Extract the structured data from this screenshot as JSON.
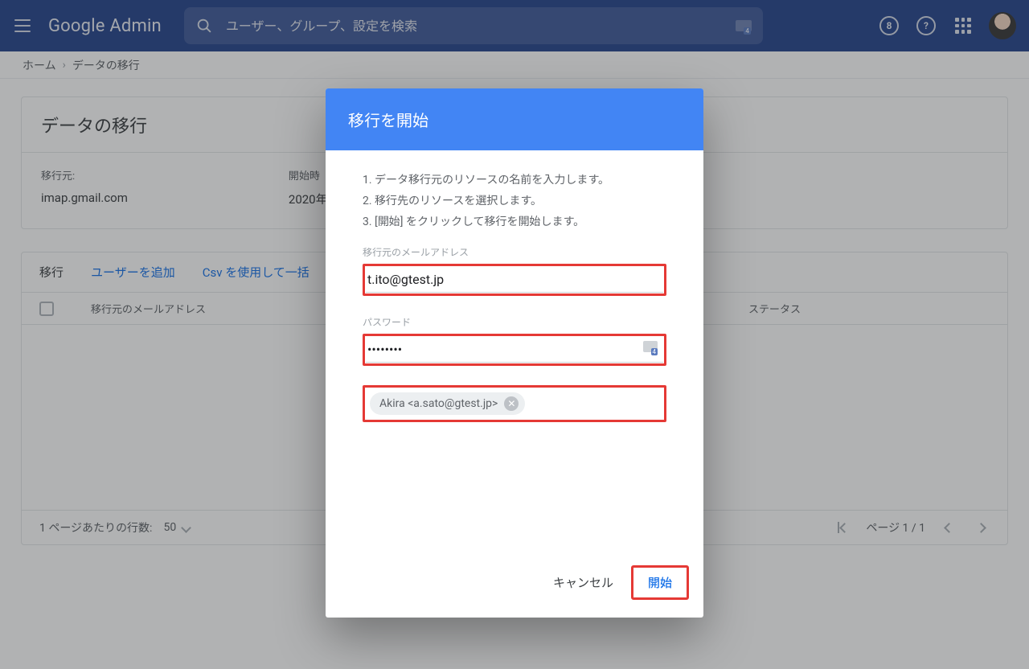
{
  "brand": {
    "g": "Google",
    "prod": " Admin"
  },
  "search": {
    "placeholder": "ユーザー、グループ、設定を検索"
  },
  "breadcrumb": {
    "home": "ホーム",
    "current": "データの移行"
  },
  "card": {
    "title": "データの移行",
    "source_label": "移行元:",
    "source_value": "imap.gmail.com",
    "start_label": "開始時",
    "start_value": "2020年"
  },
  "table": {
    "title": "移行",
    "add_user": "ユーザーを追加",
    "bulk_csv": "Csv を使用して一括",
    "col_source": "移行元のメールアドレス",
    "col_status": "ステータス",
    "rows_per_page_label": "1 ページあたりの行数:",
    "rows_per_page_value": "50",
    "page_label": "ページ 1 / 1"
  },
  "dialog": {
    "title": "移行を開始",
    "steps": [
      "データ移行元のリソースの名前を入力します。",
      "移行先のリソースを選択します。",
      "[開始] をクリックして移行を開始します。"
    ],
    "source_email_label": "移行元のメールアドレス",
    "source_email_value": "t.ito@gtest.jp",
    "password_label": "パスワード",
    "password_mask": "••••••••",
    "recipient_chip": "Akira <a.sato@gtest.jp>",
    "cancel": "キャンセル",
    "start": "開始"
  }
}
